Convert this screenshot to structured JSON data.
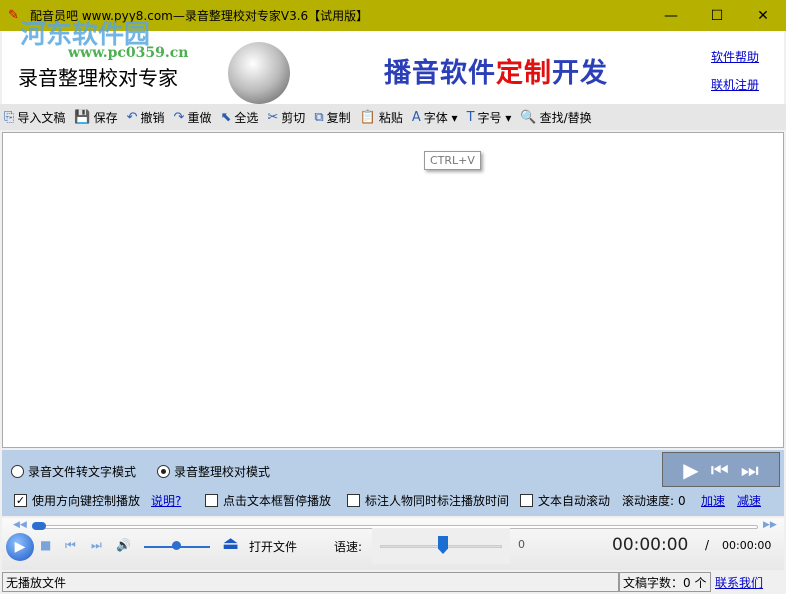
{
  "window": {
    "title": "配音员吧 www.pyy8.com—录音整理校对专家V3.6【试用版】",
    "minimize": "—",
    "maximize": "☐",
    "close": "✕"
  },
  "banner": {
    "watermark": "河东软件园",
    "watermark_url": "www.pc0359.cn",
    "app_title": "录音整理校对专家",
    "slogan_a": "播音软件",
    "slogan_b": "定制",
    "slogan_c": "开发",
    "help_link": "软件帮助",
    "register_link": "联机注册"
  },
  "toolbar": [
    {
      "icon": "⎘",
      "label": "导入文稿"
    },
    {
      "icon": "💾",
      "label": "保存"
    },
    {
      "icon": "↶",
      "label": "撤销"
    },
    {
      "icon": "↷",
      "label": "重做"
    },
    {
      "icon": "⬉",
      "label": "全选"
    },
    {
      "icon": "✂",
      "label": "剪切"
    },
    {
      "icon": "⧉",
      "label": "复制"
    },
    {
      "icon": "📋",
      "label": "粘贴"
    },
    {
      "icon": "A",
      "label": "字体 ▾"
    },
    {
      "icon": "T",
      "label": "字号 ▾"
    },
    {
      "icon": "🔍",
      "label": "查找/替换"
    }
  ],
  "editor": {
    "tooltip": "CTRL+V"
  },
  "modes": {
    "mode1": "录音文件转文字模式",
    "mode2": "录音整理校对模式",
    "selected": "mode2"
  },
  "options": {
    "arrow_keys": "使用方向键控制播放",
    "arrow_keys_checked": true,
    "explain_link": "说明?",
    "click_pause": "点击文本框暂停播放",
    "mark_time": "标注人物同时标注播放时间",
    "auto_scroll": "文本自动滚动",
    "scroll_speed_label": "滚动速度:",
    "scroll_speed": "0",
    "speed_up": "加速",
    "slow_down": "减速"
  },
  "player": {
    "open_file": "打开文件",
    "speed_label": "语速:",
    "speed_value": "0",
    "time_current": "00:00:00",
    "separator": "/",
    "time_total": "00:00:00"
  },
  "status": {
    "file": "无播放文件",
    "word_count": "文稿字数：0 个",
    "contact": "联系我们"
  }
}
